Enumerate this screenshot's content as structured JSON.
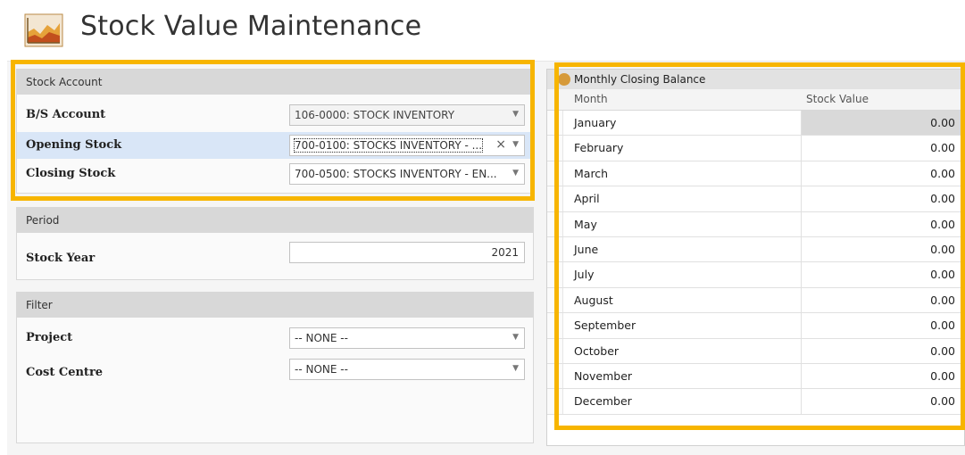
{
  "window": {
    "title": "Stock Value Maintenance"
  },
  "stock_account": {
    "header": "Stock Account",
    "bs_account": {
      "label": "B/S Account",
      "value": "106-0000: STOCK INVENTORY"
    },
    "opening_stock": {
      "label": "Opening Stock",
      "value": "700-0100: STOCKS INVENTORY - ..."
    },
    "closing_stock": {
      "label": "Closing Stock",
      "value": "700-0500: STOCKS INVENTORY - EN..."
    }
  },
  "period": {
    "header": "Period",
    "stock_year": {
      "label": "Stock Year",
      "value": "2021"
    }
  },
  "filter": {
    "header": "Filter",
    "project": {
      "label": "Project",
      "value": "-- NONE --"
    },
    "cost_centre": {
      "label": "Cost Centre",
      "value": "-- NONE --"
    }
  },
  "monthly": {
    "title": "Monthly Closing Balance",
    "col_month": "Month",
    "col_value": "Stock Value",
    "rows": [
      {
        "month": "January",
        "value": "0.00"
      },
      {
        "month": "February",
        "value": "0.00"
      },
      {
        "month": "March",
        "value": "0.00"
      },
      {
        "month": "April",
        "value": "0.00"
      },
      {
        "month": "May",
        "value": "0.00"
      },
      {
        "month": "June",
        "value": "0.00"
      },
      {
        "month": "July",
        "value": "0.00"
      },
      {
        "month": "August",
        "value": "0.00"
      },
      {
        "month": "September",
        "value": "0.00"
      },
      {
        "month": "October",
        "value": "0.00"
      },
      {
        "month": "November",
        "value": "0.00"
      },
      {
        "month": "December",
        "value": "0.00"
      }
    ]
  },
  "icons": {
    "clear": "×",
    "dropdown": "▼"
  },
  "colors": {
    "highlight": "#f7b500",
    "selected_row": "#d9e6f7",
    "group_header": "#d8d8d8"
  }
}
